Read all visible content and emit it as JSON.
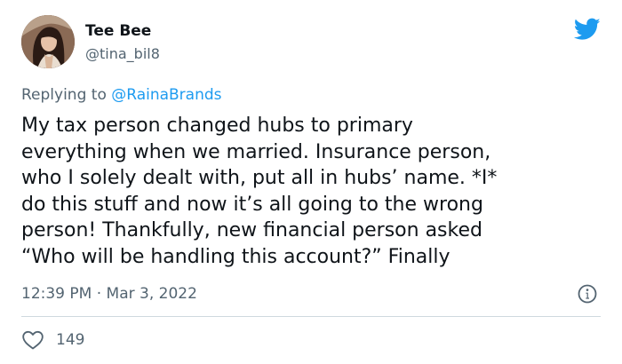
{
  "author": {
    "name": "Tee Bee",
    "handle": "@tina_bil8"
  },
  "reply": {
    "prefix": "Replying to ",
    "mention": "@RainaBrands"
  },
  "body_lines": [
    "My tax person changed hubs to primary",
    "everything when we married. Insurance person,",
    "who I solely dealt with, put all in hubs’ name. *I*",
    "do this stuff and now it’s all going to the wrong",
    "person! Thankfully, new financial person asked",
    "“Who will be handling this account?” Finally"
  ],
  "meta": {
    "time": "12:39 PM",
    "separator": " · ",
    "date": "Mar 3, 2022"
  },
  "actions": {
    "like_count": "149"
  },
  "icons": {
    "brand": "twitter-bird-icon",
    "info": "info-icon",
    "like": "heart-icon"
  },
  "colors": {
    "brand_blue": "#1d9bf0",
    "text_primary": "#0f1419",
    "text_secondary": "#536471",
    "divider": "#cfd9de"
  }
}
